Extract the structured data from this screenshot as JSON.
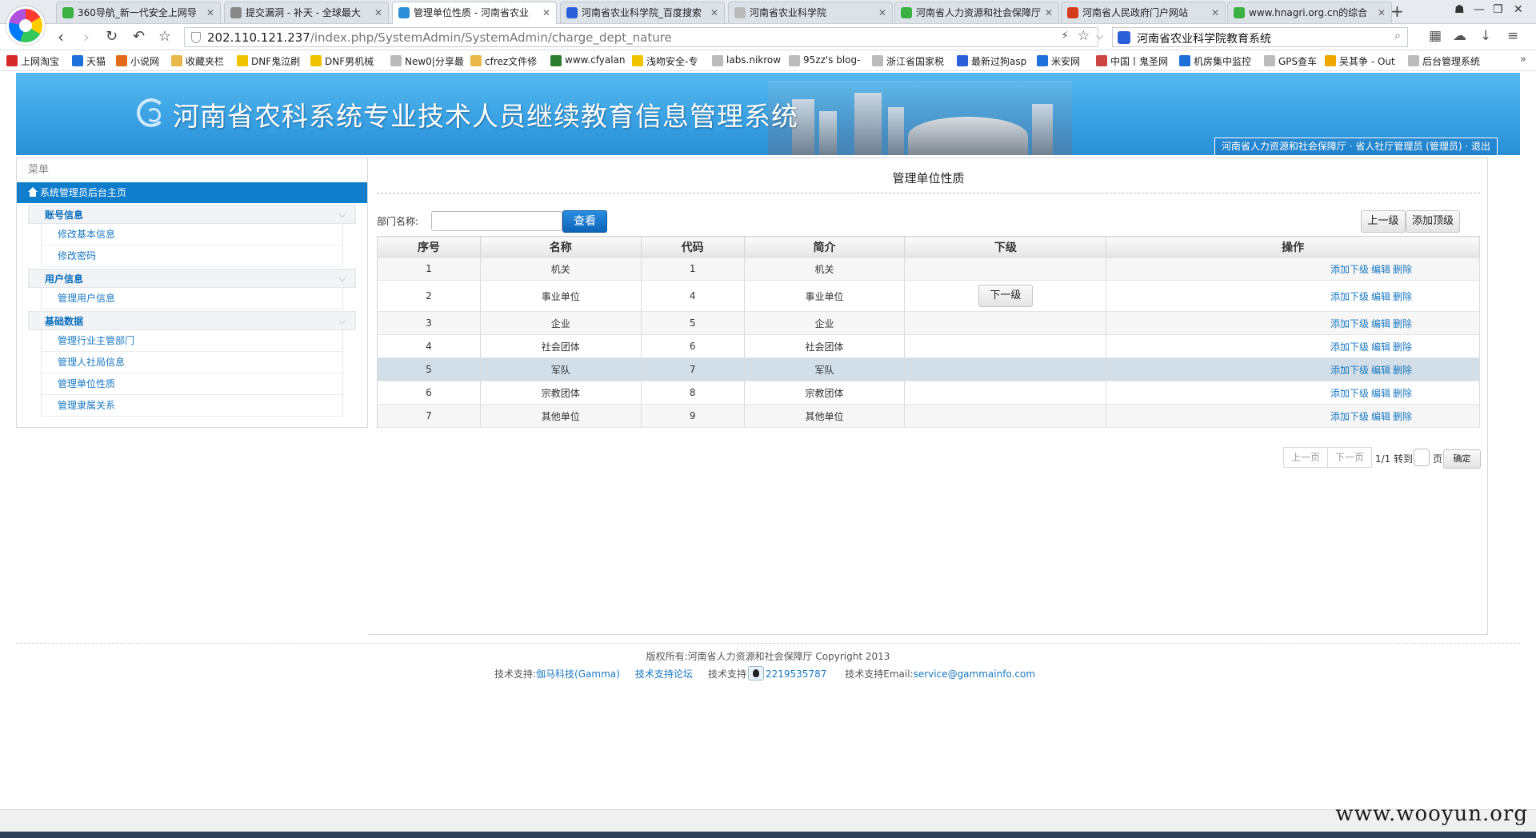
{
  "browser": {
    "tabs": [
      {
        "label": "360导航_新一代安全上网导",
        "color": "#3cb043"
      },
      {
        "label": "提交漏洞 - 补天 - 全球最大",
        "color": "#888888"
      },
      {
        "label": "管理单位性质 - 河南省农业",
        "color": "#2a8fd6"
      },
      {
        "label": "河南省农业科学院_百度搜索",
        "color": "#2b5fd9"
      },
      {
        "label": "河南省农业科学院",
        "color": "#bbbbbb"
      },
      {
        "label": "河南省人力资源和社会保障厅",
        "color": "#3cb043"
      },
      {
        "label": "河南省人民政府门户网站",
        "color": "#d63b1f"
      },
      {
        "label": "www.hnagri.org.cn的综合",
        "color": "#3cb043"
      }
    ],
    "url_main": "202.110.121.237",
    "url_path": "/index.php/SystemAdmin/SystemAdmin/charge_dept_nature",
    "search_text": "河南省农业科学院教育系统",
    "bookmarks": [
      {
        "label": "上网淘宝",
        "color": "#d62a2a"
      },
      {
        "label": "天猫",
        "color": "#1e6fd9"
      },
      {
        "label": "小说网",
        "color": "#e46b1a"
      },
      {
        "label": "收藏夹栏",
        "color": "#e8b84a"
      },
      {
        "label": "DNF鬼泣刷",
        "color": "#f0c400"
      },
      {
        "label": "DNF男机械",
        "color": "#f0c400"
      },
      {
        "label": "New0|分享最",
        "color": "#bbbbbb"
      },
      {
        "label": "cfrez文件修",
        "color": "#e8b84a"
      },
      {
        "label": "www.cfyalan",
        "color": "#2f7d2f"
      },
      {
        "label": "浅吻安全-专",
        "color": "#f0c400"
      },
      {
        "label": "labs.nikrow",
        "color": "#bbbbbb"
      },
      {
        "label": "95zz's blog-",
        "color": "#bbbbbb"
      },
      {
        "label": "浙江省国家税",
        "color": "#bbbbbb"
      },
      {
        "label": "最新过狗asp",
        "color": "#2b5fd9"
      },
      {
        "label": "米安网",
        "color": "#1e6fd9"
      },
      {
        "label": "中国丨鬼圣网",
        "color": "#cc4444"
      },
      {
        "label": "机房集中监控",
        "color": "#1e6fd9"
      },
      {
        "label": "GPS查车",
        "color": "#bbbbbb"
      },
      {
        "label": "吴其争 - Out",
        "color": "#f0a800"
      },
      {
        "label": "后台管理系统",
        "color": "#bbbbbb"
      }
    ]
  },
  "header": {
    "site_title": "河南省农科系统专业技术人员继续教育信息管理系统",
    "user_info": "河南省人力资源和社会保障厅 · 省人社厅管理员 (管理员) · 退出"
  },
  "sidebar": {
    "title": "菜单",
    "home": "系统管理员后台主页",
    "groups": [
      {
        "label": "账号信息",
        "items": [
          "修改基本信息",
          "修改密码"
        ]
      },
      {
        "label": "用户信息",
        "items": [
          "管理用户信息"
        ]
      },
      {
        "label": "基础数据",
        "items": [
          "管理行业主管部门",
          "管理人社局信息",
          "管理单位性质",
          "管理隶属关系"
        ]
      }
    ]
  },
  "main": {
    "title": "管理单位性质",
    "filter_label": "部门名称:",
    "filter_value": "",
    "query_button": "查看",
    "up_button": "上一级",
    "add_top_button": "添加顶级",
    "columns": [
      "序号",
      "名称",
      "代码",
      "简介",
      "下级",
      "操作"
    ],
    "rows": [
      {
        "no": "1",
        "name": "机关",
        "code": "1",
        "desc": "机关",
        "sub": ""
      },
      {
        "no": "2",
        "name": "事业单位",
        "code": "4",
        "desc": "事业单位",
        "sub": "下一级"
      },
      {
        "no": "3",
        "name": "企业",
        "code": "5",
        "desc": "企业",
        "sub": ""
      },
      {
        "no": "4",
        "name": "社会团体",
        "code": "6",
        "desc": "社会团体",
        "sub": ""
      },
      {
        "no": "5",
        "name": "军队",
        "code": "7",
        "desc": "军队",
        "sub": ""
      },
      {
        "no": "6",
        "name": "宗教团体",
        "code": "8",
        "desc": "宗教团体",
        "sub": ""
      },
      {
        "no": "7",
        "name": "其他单位",
        "code": "9",
        "desc": "其他单位",
        "sub": ""
      }
    ],
    "ops": [
      "添加下级",
      "编辑",
      "删除"
    ],
    "pager": {
      "prev": "上一页",
      "next": "下一页",
      "info": "1/1 转到",
      "page_unit": "页",
      "go": "确定"
    }
  },
  "footer": {
    "copyright": "版权所有:河南省人力资源和社会保障厅 Copyright 2013",
    "support_label": "技术支持:",
    "support_company": "伽马科技(Gamma)",
    "forum": "技术支持论坛",
    "qq_label": "技术支持",
    "qq_number": "2219535787",
    "email_label": "技术支持Email:",
    "email": "service@gammainfo.com"
  },
  "watermark": "www.wooyun.org"
}
